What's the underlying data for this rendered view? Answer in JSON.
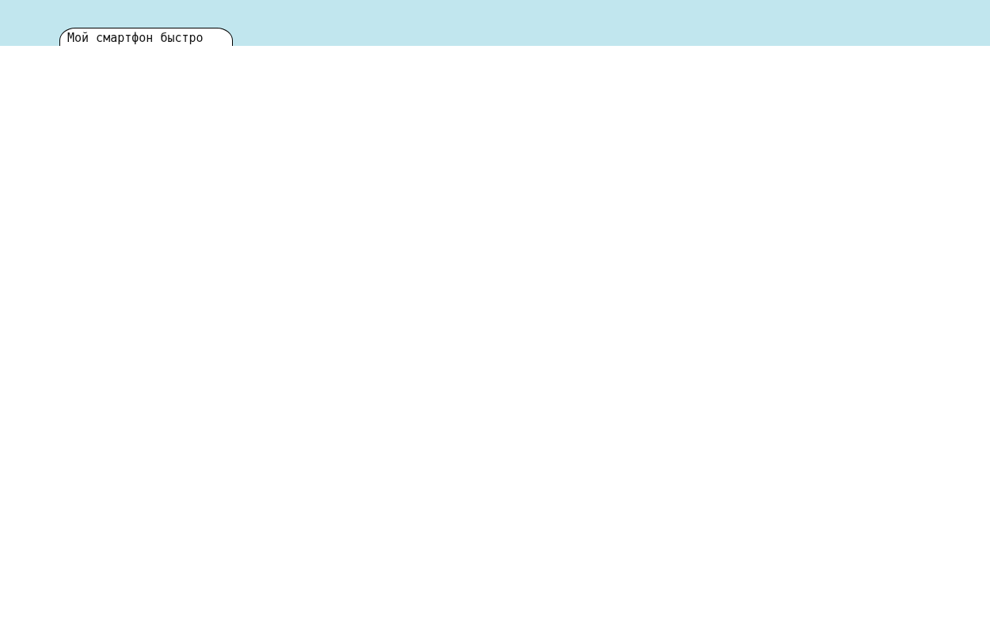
{
  "chat_bubble": {
    "text": "Мой смартфон быстро"
  }
}
